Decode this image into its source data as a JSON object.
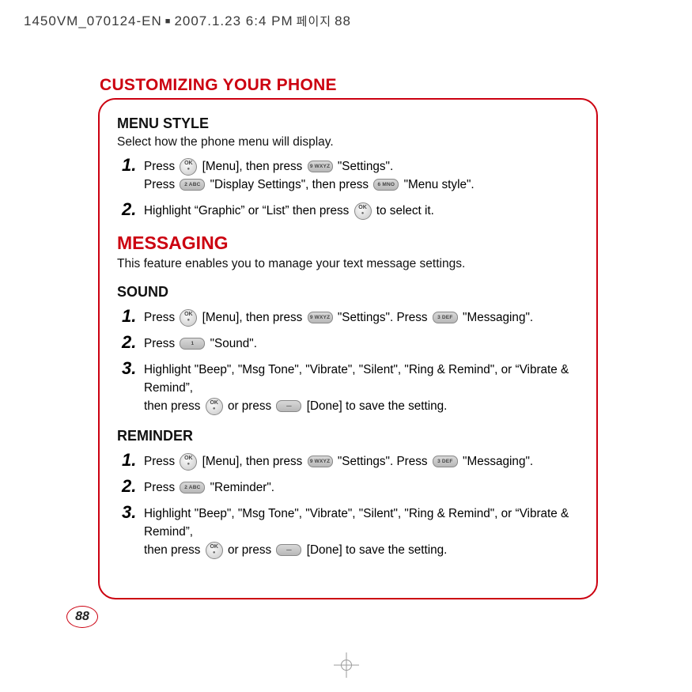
{
  "header": {
    "filename": "1450VM_070124-EN",
    "timestamp": "2007.1.23 6:4 PM",
    "korean": "페이지",
    "pageno_inline": "88"
  },
  "page_title": "CUSTOMIZING YOUR PHONE",
  "page_number": "88",
  "menu_style": {
    "heading": "MENU STYLE",
    "desc": "Select how the phone menu will display.",
    "steps": {
      "s1a": "Press",
      "s1a2": "[Menu], then press",
      "s1a3": "\"Settings\".",
      "s1b": "Press",
      "s1b2": "\"Display Settings\", then press",
      "s1b3": "\"Menu style\".",
      "s2a": "Highlight “Graphic” or “List” then press",
      "s2b": "to select it."
    }
  },
  "messaging": {
    "heading": "MESSAGING",
    "desc": "This feature enables you to manage your text message settings."
  },
  "sound": {
    "heading": "SOUND",
    "steps": {
      "s1a": "Press",
      "s1b": "[Menu], then press",
      "s1c": "\"Settings\".  Press",
      "s1d": "\"Messaging\".",
      "s2a": "Press",
      "s2b": "\"Sound\".",
      "s3a": "Highlight \"Beep\", \"Msg Tone\", \"Vibrate\", \"Silent\", \"Ring & Remind\", or “Vibrate & Remind”,",
      "s3b": "then press",
      "s3c": "or press",
      "s3d": "[Done] to save the setting."
    }
  },
  "reminder": {
    "heading": "REMINDER",
    "steps": {
      "s1a": "Press",
      "s1b": "[Menu], then press",
      "s1c": "\"Settings\".  Press",
      "s1d": "\"Messaging\".",
      "s2a": "Press",
      "s2b": "\"Reminder\".",
      "s3a": "Highlight \"Beep\", \"Msg Tone\", \"Vibrate\", \"Silent\", \"Ring & Remind\", or “Vibrate & Remind”,",
      "s3b": "then press",
      "s3c": "or press",
      "s3d": "[Done] to save the setting."
    }
  },
  "keys": {
    "ok": "OK",
    "k9": "9 WXYZ",
    "k2": "2 ABC",
    "k6": "6 MNO",
    "k3": "3 DEF",
    "k1": "1",
    "dash": "—"
  }
}
